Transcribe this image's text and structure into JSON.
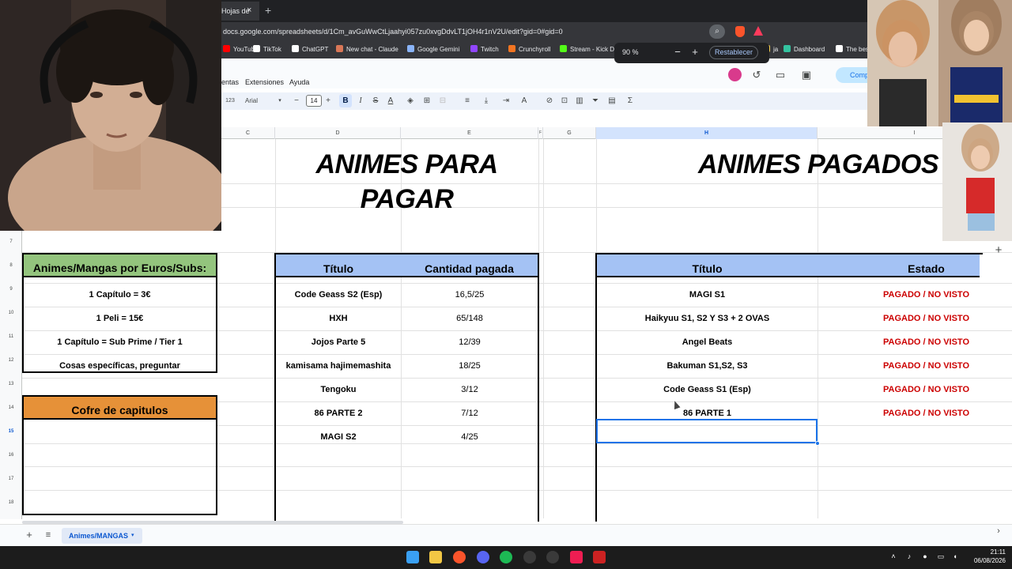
{
  "browser": {
    "tab_title": "Hojas de",
    "tab_close": "×",
    "new_tab": "+",
    "url": "docs.google.com/spreadsheets/d/1Cm_avGuWwCtLjaahyi057zu0xvgDdvLT1jOH4r1nV2U/edit?gid=0#gid=0",
    "bookmarks": [
      {
        "label": "YouTube",
        "color": "#ff0000"
      },
      {
        "label": "TikTok",
        "color": "#ffffff"
      },
      {
        "label": "ChatGPT",
        "color": "#ffffff"
      },
      {
        "label": "New chat - Claude",
        "color": "#d97757"
      },
      {
        "label": "Google Gemini",
        "color": "#8ab4f8"
      },
      {
        "label": "Twitch",
        "color": "#9146ff"
      },
      {
        "label": "Crunchyroll",
        "color": "#f47521"
      },
      {
        "label": "Stream - Kick D",
        "color": "#53fc18"
      },
      {
        "label": "ja",
        "color": "#ffd54f"
      },
      {
        "label": "Dashboard",
        "color": "#34c3a0"
      },
      {
        "label": "The best",
        "color": "#ffffff"
      }
    ]
  },
  "zoom_popup": {
    "level": "90 %",
    "minus": "−",
    "plus": "+",
    "reset": "Restablecer"
  },
  "sheets": {
    "menus": [
      "entas",
      "Extensiones",
      "Ayuda"
    ],
    "share_partial": "Comp",
    "toolbar": {
      "format_123": "123",
      "font": "Arial",
      "font_caret": "▾",
      "decrease": "−",
      "font_size": "14",
      "increase": "+",
      "bold": "B",
      "italic": "I",
      "strike": "S",
      "text_color": "A",
      "sigma": "Σ"
    },
    "columns": [
      "C",
      "D",
      "E",
      "F",
      "G",
      "H",
      "I"
    ],
    "rows": [
      "7",
      "8",
      "9",
      "10",
      "11",
      "12",
      "13",
      "14",
      "15",
      "16",
      "17",
      "18"
    ],
    "titles": {
      "left": "ANIMES PARA PAGAR",
      "right": "ANIMES PAGADOS"
    },
    "pricing": {
      "header": "Animes/Mangas por Euros/Subs:",
      "items": [
        "1 Capítulo = 3€",
        "1 Peli = 15€",
        "1 Capítulo = Sub Prime / Tier 1",
        "Cosas específicas, preguntar"
      ]
    },
    "cofre": {
      "header": "Cofre de capitulos"
    },
    "para_pagar": {
      "col_titulo": "Título",
      "col_cantidad": "Cantidad pagada",
      "rows": [
        {
          "titulo": "Code Geass S2 (Esp)",
          "cantidad": "16,5/25"
        },
        {
          "titulo": "HXH",
          "cantidad": "65/148"
        },
        {
          "titulo": "Jojos Parte 5",
          "cantidad": "12/39"
        },
        {
          "titulo": "kamisama hajimemashita",
          "cantidad": "18/25"
        },
        {
          "titulo": "Tengoku",
          "cantidad": "3/12"
        },
        {
          "titulo": "86 PARTE 2",
          "cantidad": "7/12"
        },
        {
          "titulo": "MAGI S2",
          "cantidad": "4/25"
        }
      ]
    },
    "pagados": {
      "col_titulo": "Título",
      "col_estado": "Estado",
      "rows": [
        {
          "titulo": "MAGI S1",
          "estado": "PAGADO / NO VISTO"
        },
        {
          "titulo": "Haikyuu S1, S2 Y S3 + 2 OVAS",
          "estado": "PAGADO / NO VISTO"
        },
        {
          "titulo": "Angel Beats",
          "estado": "PAGADO / NO VISTO"
        },
        {
          "titulo": "Bakuman S1,S2, S3",
          "estado": "PAGADO / NO VISTO"
        },
        {
          "titulo": "Code Geass S1 (Esp)",
          "estado": "PAGADO / NO VISTO"
        },
        {
          "titulo": "86 PARTE 1",
          "estado": "PAGADO / NO VISTO"
        }
      ]
    },
    "sheet_tab": "Animes/MANGAS",
    "sheet_tab_caret": "▾",
    "add_sheet": "+",
    "all_sheets": "≡"
  },
  "taskbar": {
    "time": "21:11",
    "date": "06/08/2026"
  },
  "colors": {
    "green_header": "#93c47d",
    "blue_header": "#a4c2f4",
    "orange_header": "#e69138",
    "status_red": "#cc0000"
  }
}
